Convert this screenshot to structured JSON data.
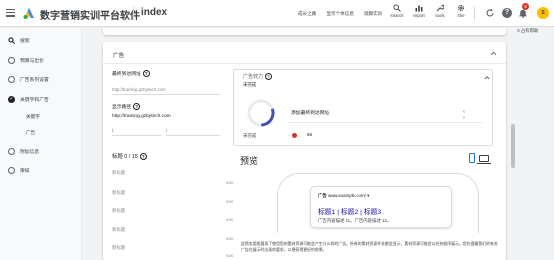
{
  "header": {
    "app_title": "数字营销实训平台软件",
    "page_name": "index",
    "links": [
      "成长之路",
      "显示个体信息",
      "观察实训"
    ],
    "tools": [
      {
        "label": "search",
        "icon": "search-icon"
      },
      {
        "label": "report",
        "icon": "report-icon"
      },
      {
        "label": "tools",
        "icon": "wrench-icon"
      },
      {
        "label": "she",
        "icon": "gear-icon"
      }
    ],
    "notification_count": "8",
    "avatar_initial": "S"
  },
  "sidebar": {
    "items": [
      {
        "label": "搜索",
        "icon": "search-icon"
      },
      {
        "label": "预算与出价",
        "icon": "circle-icon"
      },
      {
        "label": "广告系列设置",
        "icon": "circle-icon"
      },
      {
        "label": "关键字和广告",
        "icon": "check-icon"
      },
      {
        "label": "附加信息",
        "icon": "circle-icon"
      },
      {
        "label": "审核",
        "icon": "circle-icon"
      }
    ],
    "sub_items": [
      "关键字",
      "广告"
    ]
  },
  "right_panel": {
    "label": "≡ 占有帮助"
  },
  "ad_card": {
    "title": "广告",
    "final_url_label": "最终到达网址",
    "final_url_placeholder": "http://training.gzbytech.com",
    "display_path_label": "显示路径",
    "display_path_value": "http://training.gzbytech.com",
    "path_slashes": [
      "/",
      "/"
    ],
    "headlines_label": "标题 0 / 15",
    "headline_placeholder": "新标题",
    "headline_counter": "0/30",
    "headline_count_visible": 6
  },
  "ad_strength": {
    "title": "广告效力",
    "subtitle": "未完成",
    "gauge_label": "未完成",
    "gauge_fraction": 0.3,
    "item": "添加最终到达网址",
    "pager": "‹ ›",
    "score_value": "66",
    "score_color": "#d93025"
  },
  "preview": {
    "title": "预览",
    "ad_label": "广告",
    "ad_domain": "www.example.com/ ▾",
    "ad_headline": "标题1 | 标题2 | 标题3",
    "ad_description": "广告内容描述 11。广告内容描述 12。",
    "disclaimer": "此预览类图展现了使用您的素材资源可能会产生什么样的广告。所有的素材资源并非都会显示，素材资源可能会以任何顺序展示。您应遵循我们的有关广告在展示时出现的要求，以便获得更好的效果。"
  },
  "colors": {
    "accent": "#1a73e8",
    "badge": "#d93025",
    "link": "#1a0dab"
  }
}
